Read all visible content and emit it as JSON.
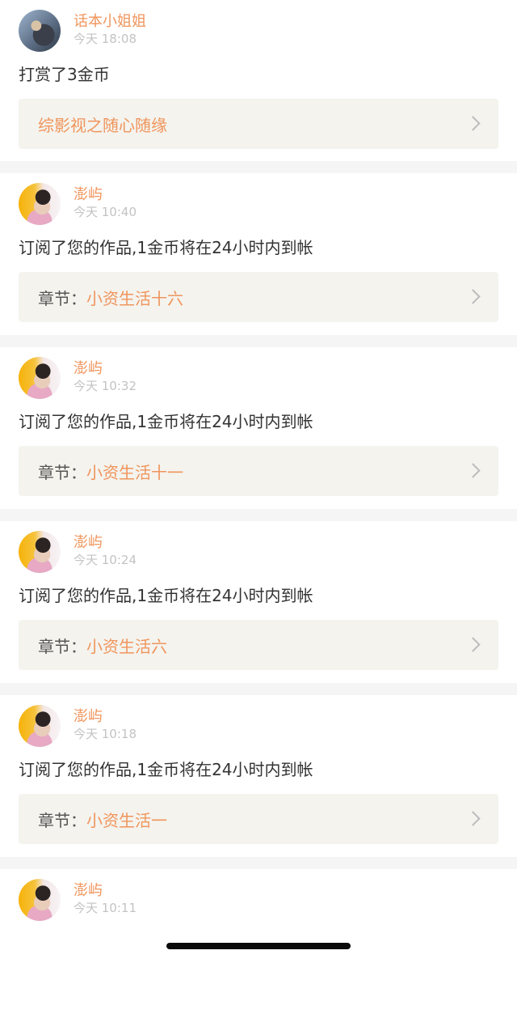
{
  "notifications": [
    {
      "user": "话本小姐姐",
      "time": "今天 18:08",
      "message": "打赏了3金币",
      "link_prefix": "",
      "link_title": "综影视之随心随缘",
      "avatar": "user-avatar-sunglasses"
    },
    {
      "user": "澎屿",
      "time": "今天 10:40",
      "message": "订阅了您的作品,1金币将在24小时内到帐",
      "link_prefix": "章节：",
      "link_title": "小资生活十六",
      "avatar": "user-avatar-portrait"
    },
    {
      "user": "澎屿",
      "time": "今天 10:32",
      "message": "订阅了您的作品,1金币将在24小时内到帐",
      "link_prefix": "章节：",
      "link_title": "小资生活十一",
      "avatar": "user-avatar-portrait"
    },
    {
      "user": "澎屿",
      "time": "今天 10:24",
      "message": "订阅了您的作品,1金币将在24小时内到帐",
      "link_prefix": "章节：",
      "link_title": "小资生活六",
      "avatar": "user-avatar-portrait"
    },
    {
      "user": "澎屿",
      "time": "今天 10:18",
      "message": "订阅了您的作品,1金币将在24小时内到帐",
      "link_prefix": "章节：",
      "link_title": "小资生活一",
      "avatar": "user-avatar-portrait"
    },
    {
      "user": "澎屿",
      "time": "今天 10:11",
      "message": "",
      "link_prefix": "",
      "link_title": "",
      "avatar": "user-avatar-portrait"
    }
  ],
  "colors": {
    "accent": "#f0955c",
    "text": "#333333",
    "muted": "#c3c3c3",
    "link_bg": "#f4f3ee",
    "page_bg": "#f5f5f5"
  }
}
